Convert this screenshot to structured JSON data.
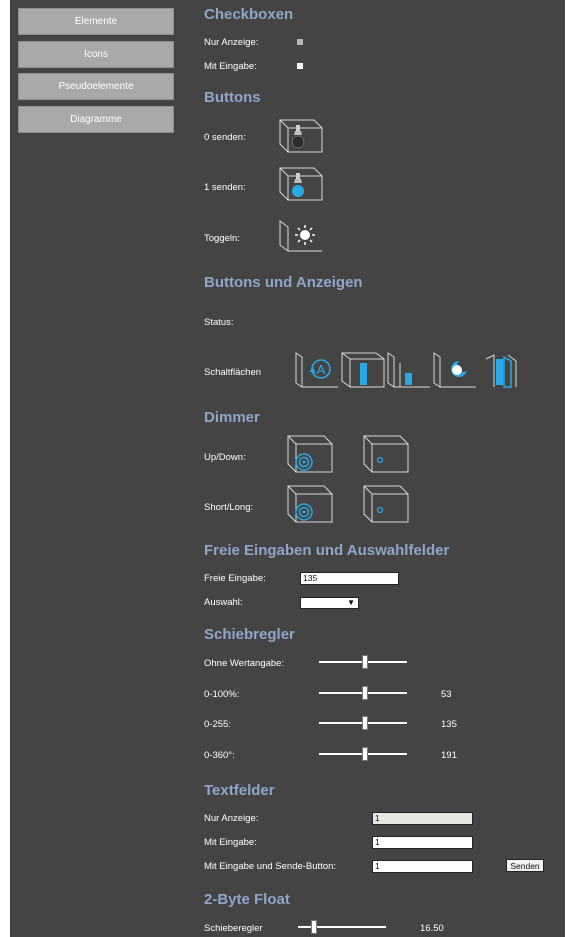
{
  "nav": [
    "Elemente",
    "Icons",
    "Pseudoelemente",
    "Diagramme"
  ],
  "sections": {
    "checkboxen": "Checkboxen",
    "buttons": "Buttons",
    "buttons_anzeigen": "Buttons und Anzeigen",
    "dimmer": "Dimmer",
    "freie": "Freie Eingaben und Auswahlfelder",
    "schiebe": "Schiebregler",
    "textfelder": "Textfelder",
    "float": "2-Byte Float"
  },
  "checkboxes": {
    "nur_anzeige": "Nur Anzeige:",
    "mit_eingabe": "Mit Eingabe:"
  },
  "buttons": {
    "send0": "0 senden:",
    "send1": "1 senden:",
    "toggle": "Toggeln:"
  },
  "buttons_anzeigen": {
    "status": "Status:",
    "schalt": "Schaltflächen"
  },
  "dimmer": {
    "updown": "Up/Down:",
    "shortlong": "Short/Long:"
  },
  "freie": {
    "eingabe_label": "Freie Eingabe:",
    "eingabe_value": "135",
    "auswahl_label": "Auswahl:",
    "auswahl_arrow": "▼"
  },
  "schiebe": [
    {
      "label": "Ohne Wertangabe:",
      "value": "",
      "fraction": 0.52
    },
    {
      "label": "0-100%:",
      "value": "53",
      "fraction": 0.53
    },
    {
      "label": "0-255:",
      "value": "135",
      "fraction": 0.53
    },
    {
      "label": "0-360°:",
      "value": "191",
      "fraction": 0.53
    }
  ],
  "textfelder": {
    "nur_label": "Nur Anzeige:",
    "nur_value": "1",
    "mit_label": "Mit Eingabe:",
    "mit_value": "1",
    "send_label": "Mit Eingabe und Sende-Button:",
    "send_value": "1",
    "send_button": "Senden"
  },
  "float": {
    "label": "Schieberegler",
    "value": "16.50",
    "fraction": 0.16
  },
  "colors": {
    "heading": "#8fa6c8",
    "accent": "#2aa8e6",
    "panel": "#444444"
  }
}
